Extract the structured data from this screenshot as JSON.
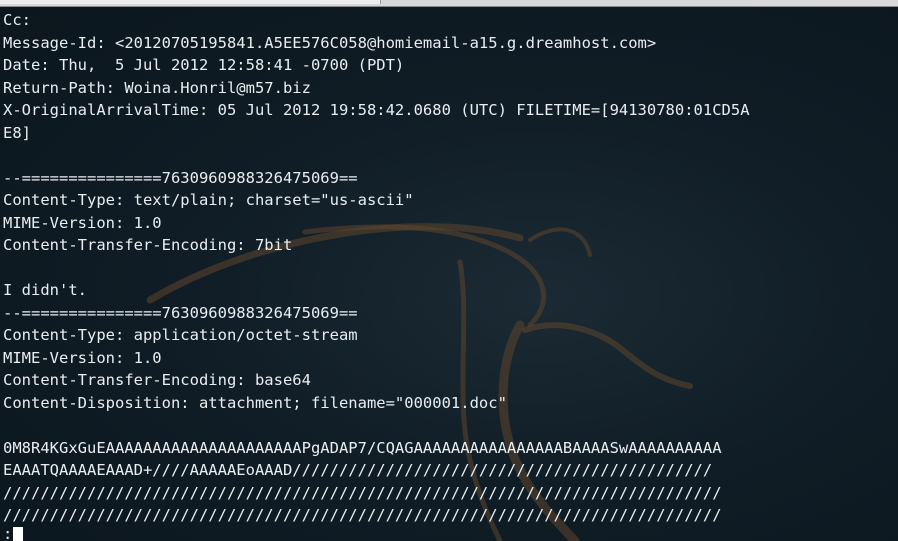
{
  "terminal": {
    "lines": [
      "Cc:",
      "Message-Id: <20120705195841.A5EE576C058@homiemail-a15.g.dreamhost.com>",
      "Date: Thu,  5 Jul 2012 12:58:41 -0700 (PDT)",
      "Return-Path: Woina.Honril@m57.biz",
      "X-OriginalArrivalTime: 05 Jul 2012 19:58:42.0680 (UTC) FILETIME=[94130780:01CD5A",
      "E8]",
      "",
      "--===============7630960988326475069==",
      "Content-Type: text/plain; charset=\"us-ascii\"",
      "MIME-Version: 1.0",
      "Content-Transfer-Encoding: 7bit",
      "",
      "I didn't.",
      "--===============7630960988326475069==",
      "Content-Type: application/octet-stream",
      "MIME-Version: 1.0",
      "Content-Transfer-Encoding: base64",
      "Content-Disposition: attachment; filename=\"000001.doc\"",
      "",
      "0M8R4KGxGuEAAAAAAAAAAAAAAAAAAAAAPgADAP7/CQAGAAAAAAAAAAAAAAAABAAAASwAAAAAAAAAA",
      "EAAATQAAAAEAAAD+////AAAAAEoAAAD/////////////////////////////////////////////",
      "/////////////////////////////////////////////////////////////////////////////",
      "/////////////////////////////////////////////////////////////////////////////"
    ],
    "prompt_line": ":"
  },
  "colors": {
    "background": "#101d26",
    "text": "#e8eef1",
    "cursor": "#ffffff",
    "watermark": "#6a4a2a"
  }
}
